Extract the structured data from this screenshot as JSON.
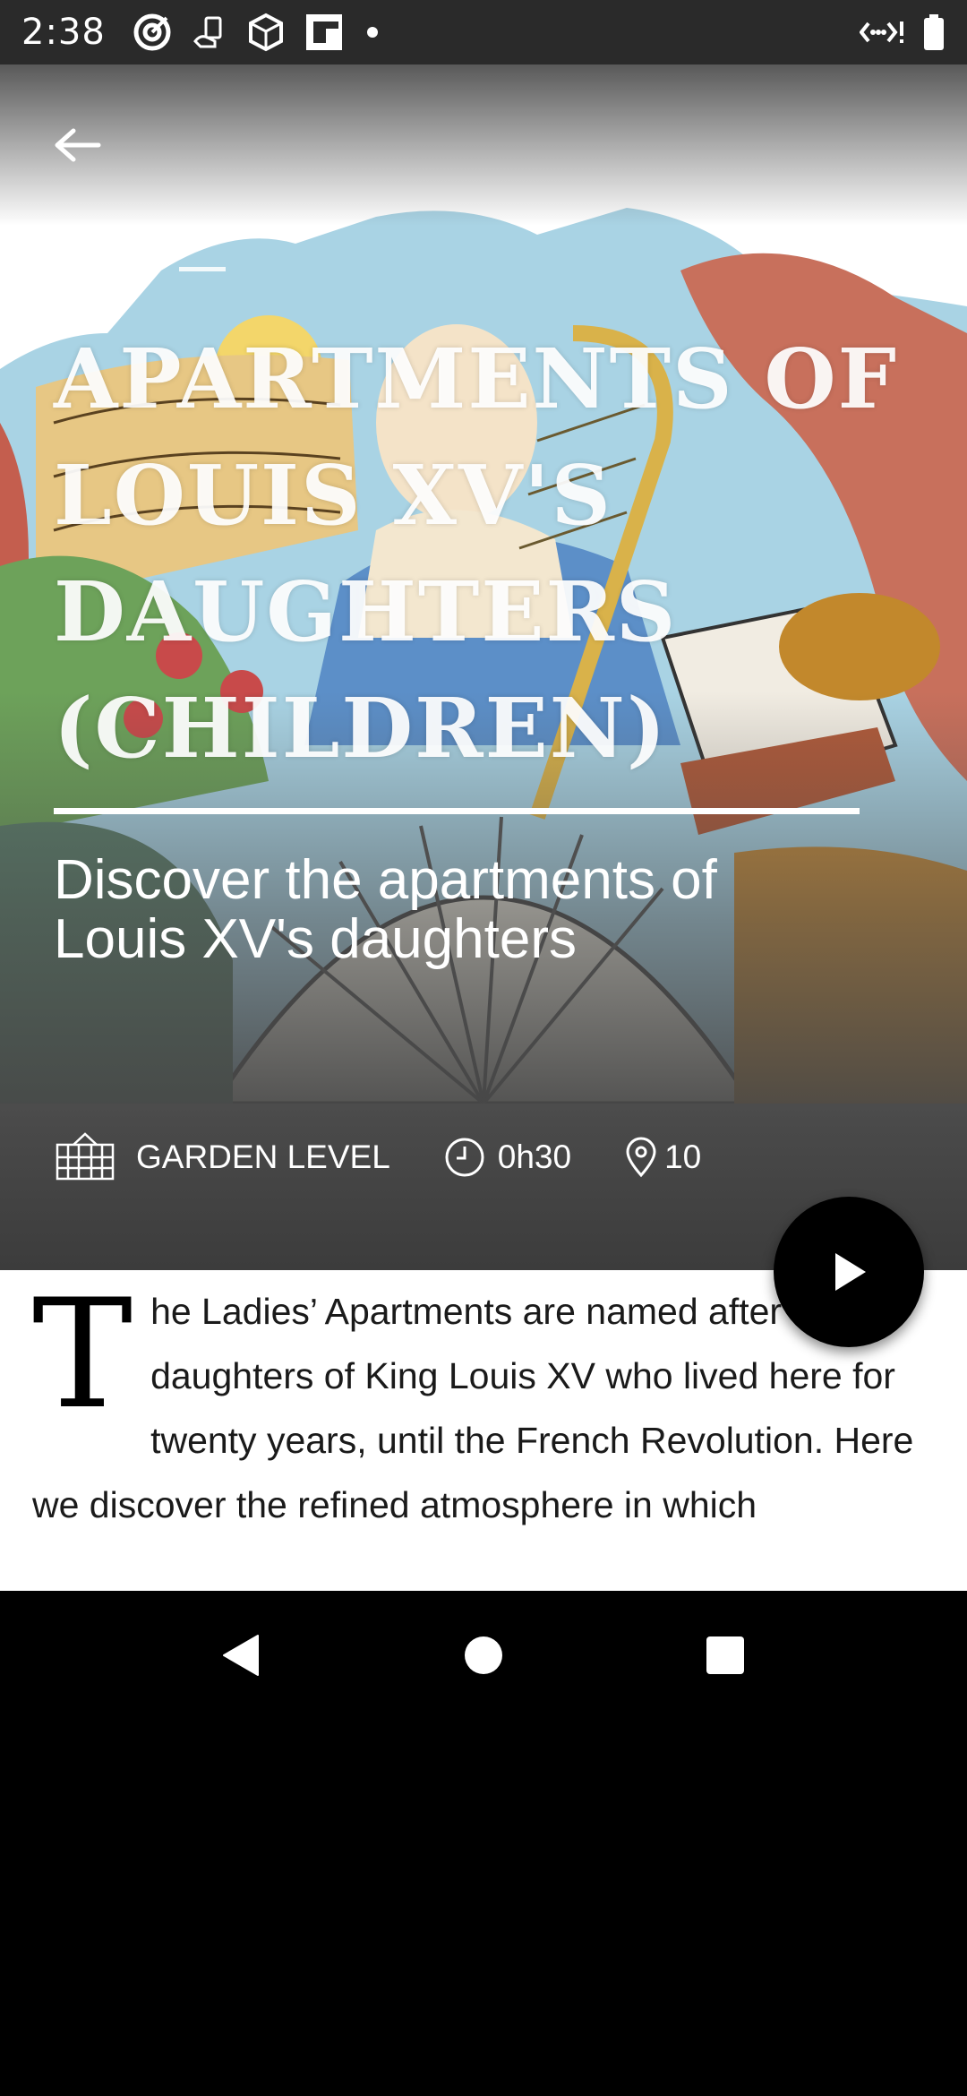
{
  "status_bar": {
    "time": "2:38",
    "left_icons": [
      "target-icon",
      "hand-notification-icon",
      "cube-icon",
      "flipboard-icon",
      "dot-icon"
    ],
    "right_icons": [
      "wifi-signal-icon",
      "battery-icon"
    ]
  },
  "header": {
    "back_icon": "arrow-left-icon"
  },
  "hero": {
    "title": "Apartments of Louis XV's Daughters (Children)",
    "subtitle": "Discover the apartments of Louis XV's daughters"
  },
  "meta": {
    "location": "GARDEN LEVEL",
    "location_icon": "palace-icon",
    "duration": "0h30",
    "duration_icon": "clock-icon",
    "stops": "10",
    "stops_icon": "map-pin-icon"
  },
  "play_button": {
    "icon": "play-icon"
  },
  "body": {
    "drop_cap": "T",
    "text": "he Ladies’ Apartments are named after the daughters of King Louis XV who lived here for twenty years, until the French Revolution. Here we discover the refined atmosphere in which"
  },
  "colors": {
    "accent": "#000000",
    "text": "#1a1a1a",
    "overlay": "#4a4a4a"
  }
}
